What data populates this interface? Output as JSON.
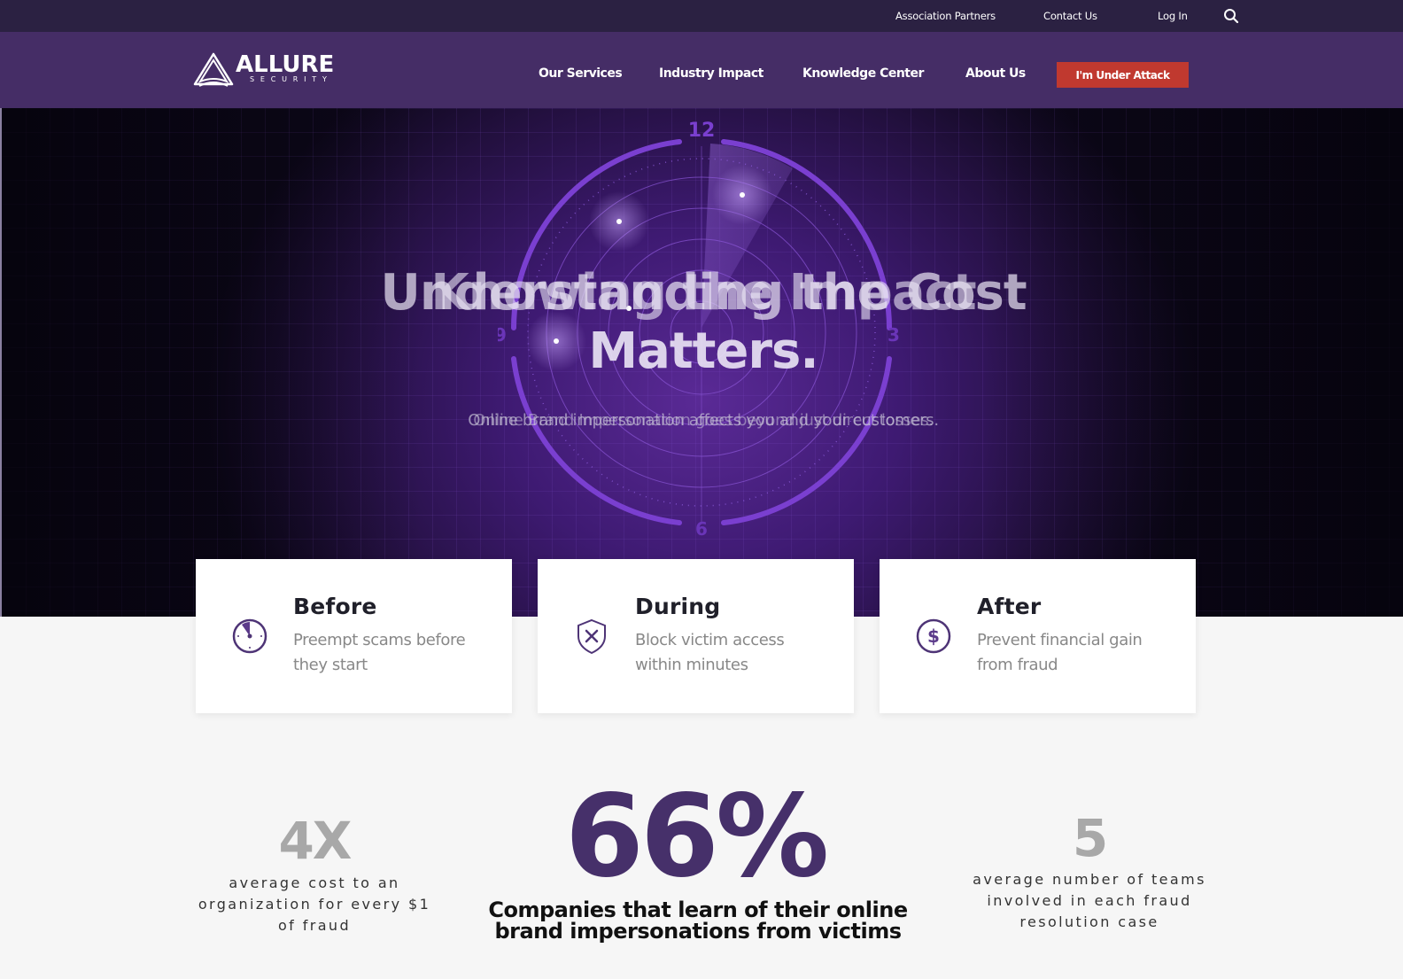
{
  "utility_nav": {
    "items": [
      "Association Partners",
      "Contact Us",
      "Log In"
    ],
    "search_icon": "search-icon"
  },
  "brand": {
    "name": "ALLURE",
    "tagline": "SECURITY"
  },
  "main_nav": {
    "items": [
      "Our Services",
      "Industry Impact",
      "Knowledge Center",
      "About Us"
    ],
    "cta_label": "I'm Under Attack",
    "cta_color": "#c0392f"
  },
  "hero": {
    "headline_a": "Understanding the Cost",
    "headline_b": "Knowing the Impact",
    "headline_line2": "Matters.",
    "subtitle_a": "Online brand impersonation affects you and your customers.",
    "subtitle_b": "Online Brand Impersonation goes beyond just direct losses.",
    "radar_labels": [
      "12",
      "3",
      "6",
      "9"
    ]
  },
  "cards": [
    {
      "title": "Before",
      "text": "Preempt scams before they start",
      "icon": "clock-icon"
    },
    {
      "title": "During",
      "text": "Block victim access within minutes",
      "icon": "shield-x-icon"
    },
    {
      "title": "After",
      "text": "Prevent financial gain from fraud",
      "icon": "dollar-circle-icon"
    }
  ],
  "stats": {
    "left": {
      "value": "4X",
      "label": "average cost to an organization for every $1 of fraud"
    },
    "center": {
      "value": "66%",
      "label": "Companies that learn of their online brand impersonations from victims"
    },
    "right": {
      "value": "5",
      "label": "average number of teams involved in each fraud resolution case"
    }
  },
  "colors": {
    "brand_purple": "#452d66",
    "utility_bar": "#2b2142",
    "stat_purple": "#46306a",
    "cta_red": "#c0392f"
  }
}
